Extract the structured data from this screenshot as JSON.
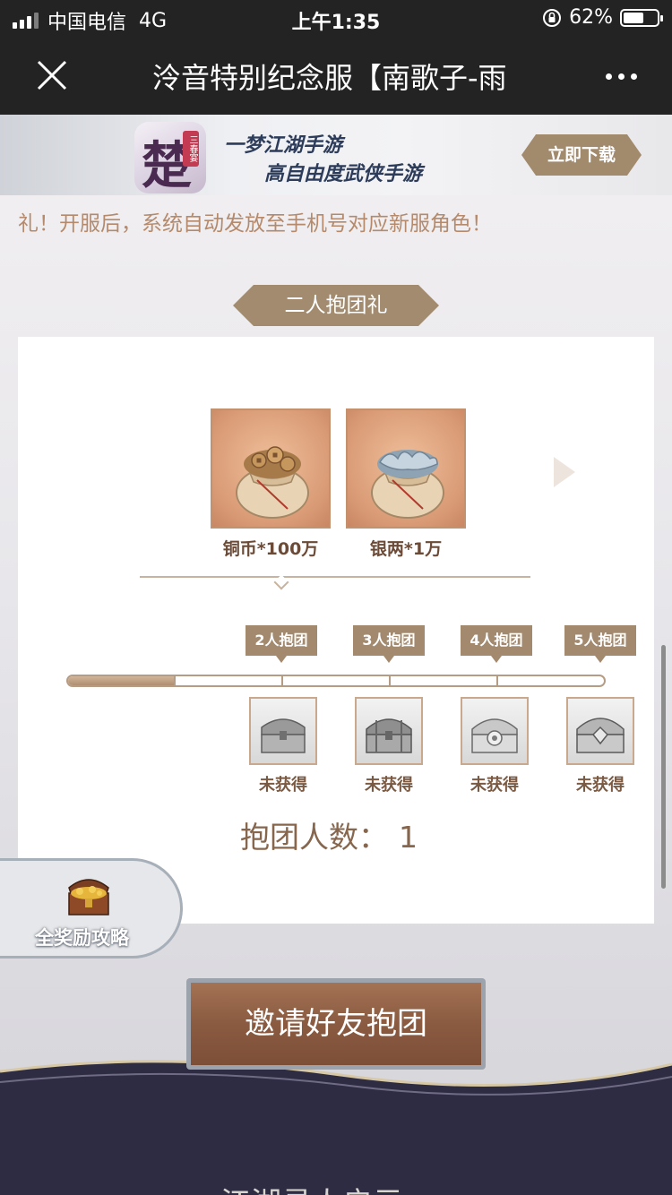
{
  "status_bar": {
    "carrier": "中国电信",
    "network": "4G",
    "time": "上午1:35",
    "battery": "62%",
    "battery_level": 0.62
  },
  "title_bar": {
    "title": "泠音特别纪念服【南歌子-雨"
  },
  "banner": {
    "app_icon_glyph": "楚",
    "app_icon_tag": "三春宴",
    "line1": "一梦江湖手游",
    "line2": "高自由度武侠手游",
    "download_label": "立即下载"
  },
  "content": {
    "intro": "礼！开服后，系统自动发放至手机号对应新服角色！",
    "section_title": "二人抱团礼",
    "rewards": [
      {
        "label": "铜币*100万",
        "icon": "copper-coin-bag-icon"
      },
      {
        "label": "银两*1万",
        "icon": "silver-ingot-bag-icon"
      }
    ],
    "milestones": [
      {
        "label": "2人抱团",
        "status": "未获得"
      },
      {
        "label": "3人抱团",
        "status": "未获得"
      },
      {
        "label": "4人抱团",
        "status": "未获得"
      },
      {
        "label": "5人抱团",
        "status": "未获得"
      }
    ],
    "progress_fraction": 0.2,
    "team_count_label": "抱团人数：",
    "team_count_value": "1",
    "guide_label": "全奖励攻略",
    "invite_label": "邀请好友抱团",
    "footer_partial_text": "江湖寻人启示"
  },
  "colors": {
    "accent_tan": "#a28b6f",
    "invite_brown": "#8a5b41",
    "intro_text": "#b58a6c",
    "dark_bar": "#232323"
  }
}
